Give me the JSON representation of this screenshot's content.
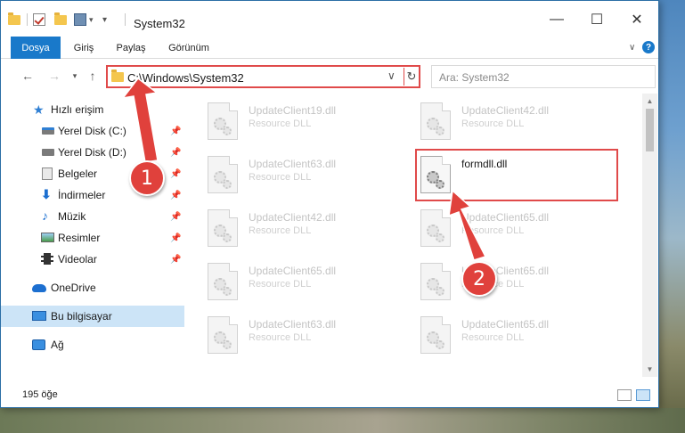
{
  "window": {
    "title": "System32",
    "controls": {
      "minimize": "—",
      "maximize": "☐",
      "close": "✕"
    }
  },
  "ribbon": {
    "tabs": [
      {
        "label": "Dosya",
        "active": true
      },
      {
        "label": "Giriş",
        "active": false
      },
      {
        "label": "Paylaş",
        "active": false
      },
      {
        "label": "Görünüm",
        "active": false
      }
    ],
    "help": "?"
  },
  "nav": {
    "address": "C:\\Windows\\System32",
    "search_placeholder": "Ara: System32"
  },
  "sidebar": {
    "items": [
      {
        "label": "Hızlı erişim",
        "icon": "star-icon"
      },
      {
        "label": "Yerel Disk (C:)",
        "icon": "drive-icon",
        "pinned": true
      },
      {
        "label": "Yerel Disk (D:)",
        "icon": "drive-icon",
        "pinned": true
      },
      {
        "label": "Belgeler",
        "icon": "documents-icon",
        "pinned": true
      },
      {
        "label": "İndirmeler",
        "icon": "download-icon",
        "pinned": true
      },
      {
        "label": "Müzik",
        "icon": "music-icon",
        "pinned": true
      },
      {
        "label": "Resimler",
        "icon": "pictures-icon",
        "pinned": true
      },
      {
        "label": "Videolar",
        "icon": "videos-icon",
        "pinned": true
      },
      {
        "label": "OneDrive",
        "icon": "onedrive-icon"
      },
      {
        "label": "Bu bilgisayar",
        "icon": "this-pc-icon",
        "selected": true
      },
      {
        "label": "Ağ",
        "icon": "network-icon"
      }
    ]
  },
  "files": {
    "left": [
      {
        "name": "UpdateClient19.dll",
        "type": "Resource DLL"
      },
      {
        "name": "UpdateClient63.dll",
        "type": "Resource DLL"
      },
      {
        "name": "UpdateClient42.dll",
        "type": "Resource DLL"
      },
      {
        "name": "UpdateClient65.dll",
        "type": "Resource DLL"
      },
      {
        "name": "UpdateClient63.dll",
        "type": "Resource DLL"
      }
    ],
    "right": [
      {
        "name": "UpdateClient42.dll",
        "type": "Resource DLL"
      },
      {
        "name": "formdll.dll",
        "type": "",
        "highlighted": true
      },
      {
        "name": "UpdateClient65.dll",
        "type": "Resource DLL"
      },
      {
        "name": "UpdateClient65.dll",
        "type": "Resource DLL"
      },
      {
        "name": "UpdateClient65.dll",
        "type": "Resource DLL"
      }
    ]
  },
  "status": {
    "item_count": "195 öğe"
  },
  "annotations": {
    "badge1": "1",
    "badge2": "2",
    "color": "#e0413c"
  }
}
